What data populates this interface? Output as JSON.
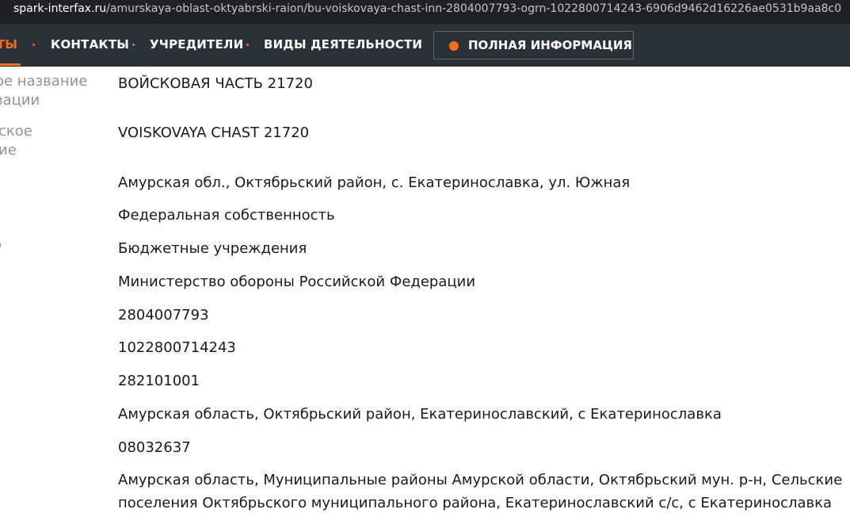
{
  "browser": {
    "url_host": "spark-interfax.ru",
    "url_path": "/amurskaya-oblast-oktyabrski-raion/bu-voiskovaya-chast-inn-2804007793-ogrn-1022800714243-6906d9462d16226ae0531b9aa8c0"
  },
  "nav": {
    "items": [
      {
        "label": "ТЫ"
      },
      {
        "label": "КОНТАКТЫ"
      },
      {
        "label": "УЧРЕДИТЕЛИ"
      },
      {
        "label": "ВИДЫ ДЕЯТЕЛЬНОСТИ"
      }
    ],
    "full_info_button": "ПОЛНАЯ ИНФОРМАЦИЯ"
  },
  "labels": [
    {
      "line1": "ое название",
      "line2": "зации"
    },
    {
      "line1": "ское",
      "line2": "ие"
    },
    {
      "line1": "о"
    }
  ],
  "values": [
    [
      "ВОЙСКОВАЯ ЧАСТЬ 21720"
    ],
    [
      "VOISKOVAYA CHAST 21720"
    ],
    [
      "Амурская обл., Октябрьский район, с. Екатеринославка, ул. Южная"
    ],
    [
      "Федеральная собственность"
    ],
    [
      "Бюджетные учреждения"
    ],
    [
      "Министерство обороны Российской Федерации"
    ],
    [
      "2804007793"
    ],
    [
      "1022800714243"
    ],
    [
      "282101001"
    ],
    [
      "Амурская область, Октябрьский район, Екатеринославский, с Екатеринославка"
    ],
    [
      "08032637"
    ],
    [
      "Амурская область, Муниципальные районы Амурской области, Октябрьский мун. р-н, Сельские",
      "поселения Октябрьского муниципального района, Екатеринославский с/с, с Екатеринославка"
    ]
  ]
}
